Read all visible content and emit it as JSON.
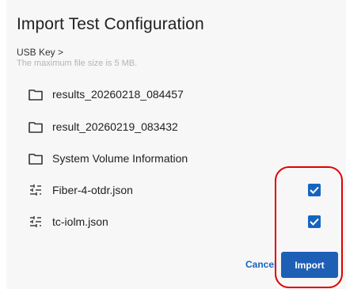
{
  "dialog": {
    "title": "Import Test Configuration",
    "breadcrumb": "USB Key >",
    "hint": "The maximum file size is 5 MB."
  },
  "items": [
    {
      "label": "results_20260218_084457",
      "icon": "folder-icon",
      "type": "folder"
    },
    {
      "label": "result_20260219_083432",
      "icon": "folder-icon",
      "type": "folder"
    },
    {
      "label": "System Volume Information",
      "icon": "folder-icon",
      "type": "folder"
    },
    {
      "label": "Fiber-4-otdr.json",
      "icon": "config-file-icon",
      "type": "file",
      "checked": true
    },
    {
      "label": "tc-iolm.json",
      "icon": "config-file-icon",
      "type": "file",
      "checked": true
    }
  ],
  "actions": {
    "cancel_label": "Cancel",
    "import_label": "Import"
  },
  "colors": {
    "accent": "#1565c0",
    "annotation": "#e00000"
  }
}
